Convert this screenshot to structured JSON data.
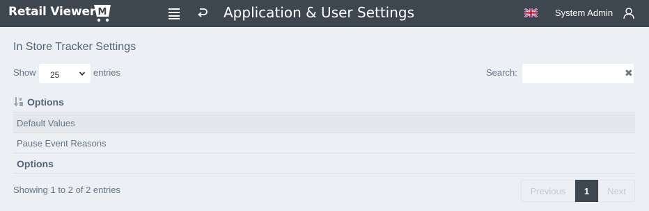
{
  "app": {
    "logo_text": "Retail Viewer",
    "logo_badge": "M",
    "page_title": "Application & User Settings"
  },
  "toolbar": {
    "menu_icon": "list-icon",
    "back_icon": "return-arrow-icon"
  },
  "user": {
    "name": "System Admin",
    "language_flag": "uk-flag-icon",
    "avatar_icon": "user-outline-icon"
  },
  "panel": {
    "title": "In Store Tracker Settings"
  },
  "table_controls": {
    "show_label": "Show",
    "page_size": "25",
    "entries_label": "entries",
    "search_label": "Search:",
    "search_value": "",
    "clear_glyph": "✖"
  },
  "table": {
    "header": "Options",
    "footer": "Options",
    "rows": [
      {
        "label": "Default Values"
      },
      {
        "label": "Pause Event Reasons"
      }
    ]
  },
  "info": "Showing 1 to 2 of 2 entries",
  "pagination": {
    "previous": "Previous",
    "current": "1",
    "next": "Next"
  },
  "colors": {
    "topbar": "#3e4650",
    "background": "#ecf0f4",
    "text": "#52637a",
    "accent_magenta": "#d1005e"
  }
}
